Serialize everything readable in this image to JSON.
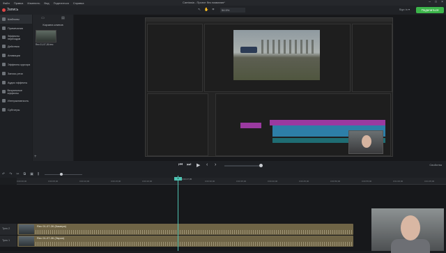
{
  "menu": [
    "Файл",
    "Правка",
    "Изменить",
    "Вид",
    "Поделиться",
    "Справка"
  ],
  "window_title": "Camtasia - Проект без названия*",
  "sign_in": "Sign in ▾",
  "toolbar": {
    "record_label": "Запись",
    "zoom_value": "54.5%",
    "share_label": "Поделиться"
  },
  "nav": [
    {
      "label": "Шаблоны",
      "active": false
    },
    {
      "label": "Примечания",
      "active": false
    },
    {
      "label": "Эффекты переходов",
      "active": false
    },
    {
      "label": "Действия",
      "active": false
    },
    {
      "label": "Анимации",
      "active": false
    },
    {
      "label": "Эффекты курсора",
      "active": false
    },
    {
      "label": "Запись речи",
      "active": false
    },
    {
      "label": "Аудио эффекты",
      "active": false
    },
    {
      "label": "Визуальные эффекты",
      "active": false
    },
    {
      "label": "Интерактивность",
      "active": false
    },
    {
      "label": "Субтитры",
      "active": false
    }
  ],
  "library": {
    "title": "Корзина клипов",
    "media_caption": "Rec 01-07-26.trec"
  },
  "playback": {
    "properties_label": "Свойства"
  },
  "timeline": {
    "ticks": [
      "0:00:00;00",
      "0:00:05;00",
      "0:00:10;00",
      "0:00:15;00",
      "0:00:20;00",
      "0:00:25;00",
      "0:00:30;00",
      "0:00:35;00",
      "0:00:40;00",
      "0:00:45;00",
      "0:00:50;00",
      "0:00:55;00",
      "0:01:00;00",
      "0:01:05;00"
    ],
    "playhead_time": "0:00:27;05",
    "tracks": [
      {
        "label": "Трек 2",
        "clip": "Rec 01-07-26 (Камера)"
      },
      {
        "label": "Трек 1",
        "clip": "Rec 01-07-26 (Экран)"
      }
    ]
  },
  "icons": {
    "record": "record-dot-icon",
    "library_tabs": [
      "media-icon",
      "library-icon"
    ],
    "playback": [
      "step-back-icon",
      "step-forward-icon",
      "play-icon",
      "prev-marker-icon",
      "next-marker-icon"
    ],
    "timeline_tools": [
      "undo-icon",
      "redo-icon",
      "cut-icon",
      "copy-icon",
      "paste-icon",
      "split-icon"
    ]
  },
  "colors": {
    "accent": "#3cb44a",
    "playhead": "#4fc3b3",
    "clip": "#6f6446"
  }
}
